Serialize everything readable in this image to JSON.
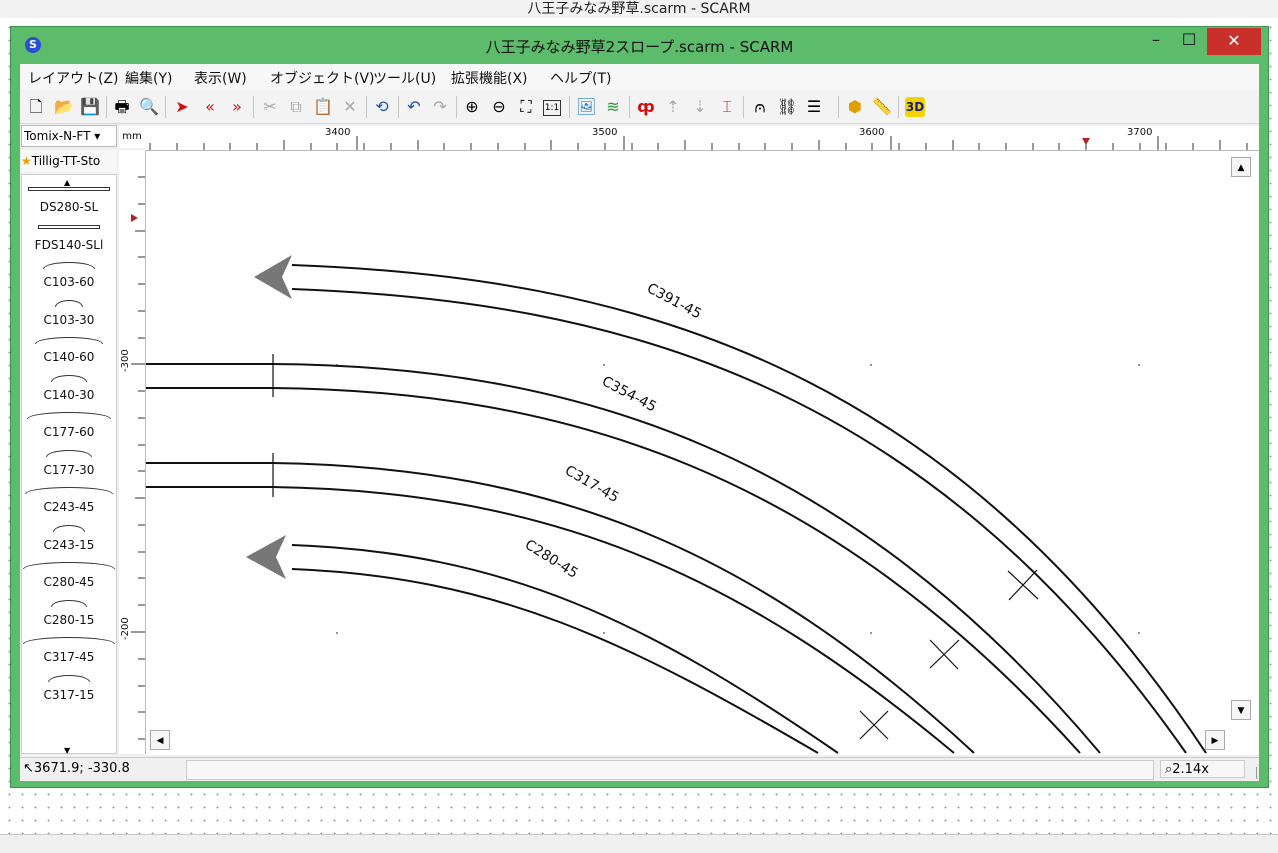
{
  "background_window": {
    "title": "八王子みなみ野草.scarm - SCARM"
  },
  "window": {
    "title": "八王子みなみ野草2スロープ.scarm - SCARM",
    "app_icon": "S",
    "minimize": "–",
    "maximize": "☐",
    "close": "✕"
  },
  "menu": [
    "レイアウト(Z)",
    "編集(Y)",
    "表示(W)",
    "オブジェクト(V)",
    "ツール(U)",
    "拡張機能(X)",
    "ヘルプ(T)"
  ],
  "toolbar": {
    "icons": [
      "new-file-icon",
      "open-folder-icon",
      "save-icon",
      "print-icon",
      "print-preview-icon",
      "select-arrow-icon",
      "prev-icon",
      "next-icon",
      "cut-icon",
      "copy-icon",
      "paste-icon",
      "delete-icon",
      "rotate-icon",
      "undo-icon",
      "redo-icon",
      "zoom-in-icon",
      "zoom-out-icon",
      "fit-icon",
      "one-to-one-icon",
      "background-image-icon",
      "layers-icon",
      "track-height-icon",
      "level-up-icon",
      "level-down-icon",
      "insulated-icon",
      "bridge-icon",
      "tunnel-icon",
      "list-icon",
      "object-icon",
      "measure-icon",
      "3d-view-icon"
    ],
    "label_1to1": "1:1",
    "label_3d": "3D"
  },
  "library": {
    "selected": "Tomix-N-FT",
    "favorite": "Tillig-TT-Sto",
    "items": [
      "DS280-SL",
      "FDS140-SLl",
      "C103-60",
      "C103-30",
      "C140-60",
      "C140-30",
      "C177-60",
      "C177-30",
      "C243-45",
      "C243-15",
      "C280-45",
      "C280-15",
      "C317-45",
      "C317-15"
    ]
  },
  "rulers": {
    "unit": "mm",
    "horizontal": [
      "3400",
      "3500",
      "3600",
      "3700"
    ],
    "vertical": [
      "-300",
      "-200"
    ]
  },
  "tracks": [
    {
      "label": "C391-45"
    },
    {
      "label": "C354-45"
    },
    {
      "label": "C317-45"
    },
    {
      "label": "C280-45"
    }
  ],
  "status": {
    "coords": "3671.9; -330.8",
    "zoom": "2.14x"
  },
  "colors": {
    "window_frame": "#5dbb6c",
    "close_button": "#c9302c",
    "marker": "#b22222"
  }
}
